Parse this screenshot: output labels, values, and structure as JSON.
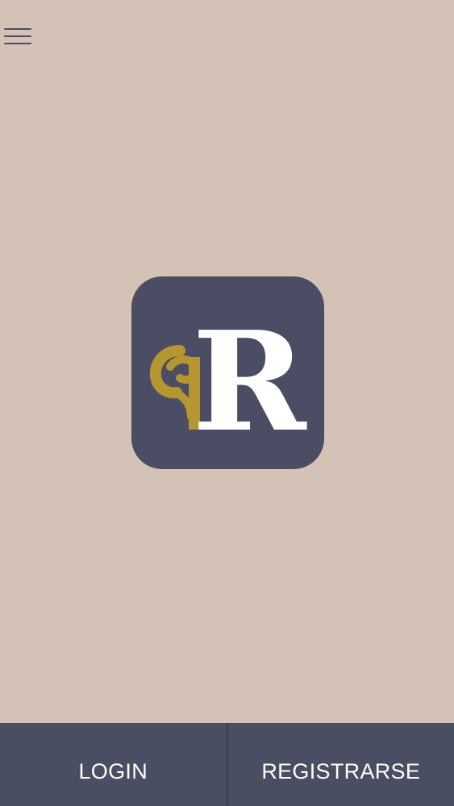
{
  "colors": {
    "background": "#d3c2b5",
    "bar": "#4a4e63",
    "logo_tile": "#4a4d64",
    "logo_gold": "#b59630",
    "logo_white": "#ffffff"
  },
  "header": {
    "menu_icon": "hamburger-menu-icon"
  },
  "logo": {
    "letter": "R"
  },
  "bottom_bar": {
    "login_label": "LOGIN",
    "register_label": "REGISTRARSE"
  }
}
